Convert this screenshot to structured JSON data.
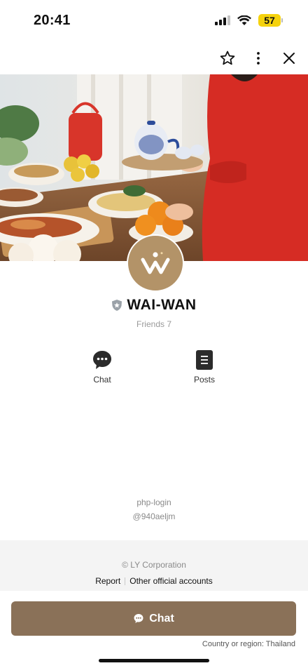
{
  "status_bar": {
    "time": "20:41",
    "battery": "57",
    "colors": {
      "battery": "#f5d20d"
    },
    "icons": [
      "signal-icon",
      "wifi-icon",
      "battery-icon"
    ]
  },
  "top_actions": {
    "icons": [
      "star-icon",
      "more-vertical-icon",
      "close-icon"
    ]
  },
  "profile": {
    "name": "WAI-WAN",
    "friends": "Friends 7",
    "badge_icon": "official-shield-icon",
    "avatar_icon": "wai-wan-logo"
  },
  "quick_actions": [
    {
      "label": "Chat",
      "icon": "chat-bubble-icon"
    },
    {
      "label": "Posts",
      "icon": "posts-icon"
    }
  ],
  "ids": {
    "channel": "php-login",
    "line_id": "@940aeljm"
  },
  "footer": {
    "copyright": "© LY Corporation",
    "links": [
      "Report",
      "Other official accounts"
    ]
  },
  "cta": {
    "label": "Chat",
    "icon": "chat-bubble-icon"
  },
  "region": "Country or region: Thailand",
  "colors": {
    "brand": "#b39368",
    "button": "#8a7158",
    "footer_bg": "#f4f4f4"
  }
}
